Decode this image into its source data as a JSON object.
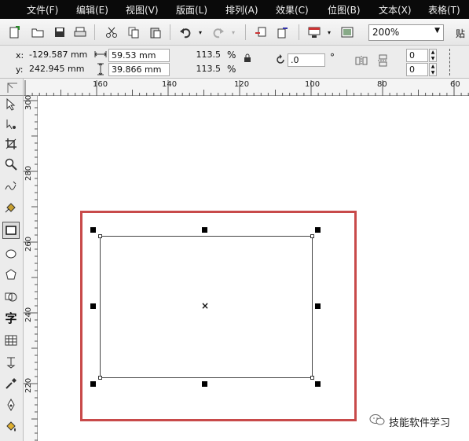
{
  "menu": {
    "items": [
      "文件(F)",
      "编辑(E)",
      "视图(V)",
      "版面(L)",
      "排列(A)",
      "效果(C)",
      "位图(B)",
      "文本(X)",
      "表格(T)"
    ]
  },
  "toolbar": {
    "zoom_value": "200%",
    "paste_label": "贴"
  },
  "property_bar": {
    "x_label": "x:",
    "x_value": "-129.587 mm",
    "y_label": "y:",
    "y_value": "242.945 mm",
    "width_value": "59.53 mm",
    "height_value": "39.866 mm",
    "scale_x": "113.5",
    "scale_y": "113.5",
    "percent_symbol": "%",
    "rotation_value": ".0",
    "degree_symbol": "°",
    "corner_top": "0",
    "corner_bottom": "0"
  },
  "ruler": {
    "horizontal_labels": [
      "160",
      "140",
      "120",
      "100",
      "80",
      "60"
    ],
    "vertical_labels": [
      "300",
      "280",
      "260",
      "240",
      "220"
    ]
  },
  "toolbox": {
    "text_tool_label": "字"
  },
  "watermark": {
    "text": "技能软件学习"
  },
  "colors": {
    "menubar_bg": "#0a0a0a",
    "highlight_border": "#c84a4a"
  }
}
